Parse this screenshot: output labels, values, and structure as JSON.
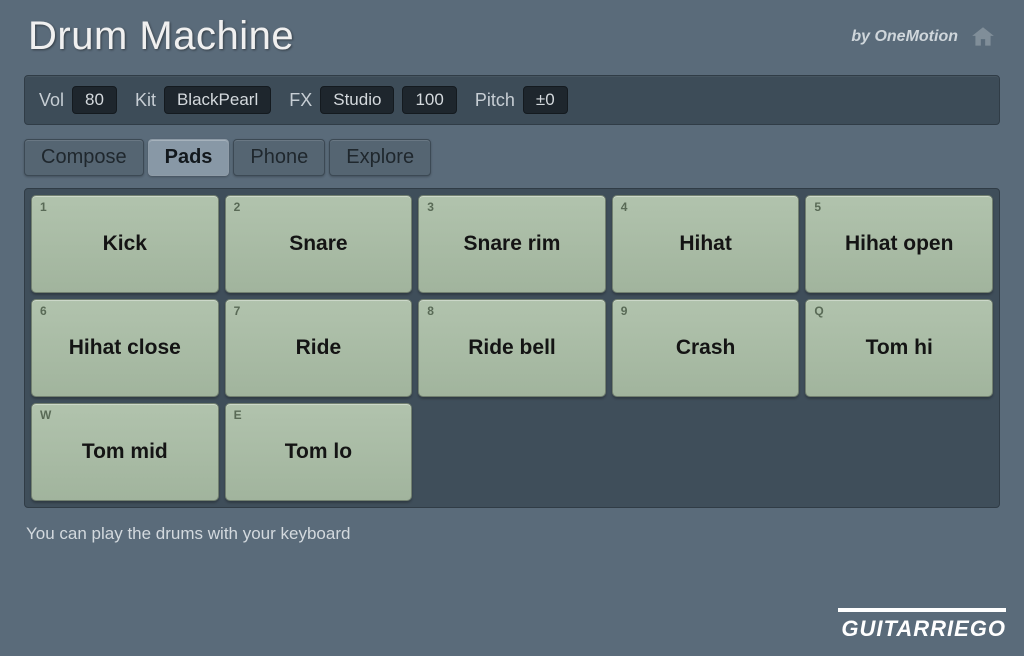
{
  "header": {
    "title": "Drum Machine",
    "byline": "by OneMotion"
  },
  "controls": {
    "vol": {
      "label": "Vol",
      "value": "80"
    },
    "kit": {
      "label": "Kit",
      "value": "BlackPearl"
    },
    "fx": {
      "label": "FX",
      "value": "Studio",
      "amount": "100"
    },
    "pitch": {
      "label": "Pitch",
      "value": "±0"
    }
  },
  "tabs": {
    "compose": "Compose",
    "pads": "Pads",
    "phone": "Phone",
    "explore": "Explore",
    "active": "pads"
  },
  "pads": [
    {
      "key": "1",
      "label": "Kick"
    },
    {
      "key": "2",
      "label": "Snare"
    },
    {
      "key": "3",
      "label": "Snare rim"
    },
    {
      "key": "4",
      "label": "Hihat"
    },
    {
      "key": "5",
      "label": "Hihat open"
    },
    {
      "key": "6",
      "label": "Hihat close"
    },
    {
      "key": "7",
      "label": "Ride"
    },
    {
      "key": "8",
      "label": "Ride bell"
    },
    {
      "key": "9",
      "label": "Crash"
    },
    {
      "key": "Q",
      "label": "Tom hi"
    },
    {
      "key": "W",
      "label": "Tom mid"
    },
    {
      "key": "E",
      "label": "Tom lo"
    }
  ],
  "help": "You can play the drums with your keyboard",
  "watermark": "GUITARRIEGO"
}
